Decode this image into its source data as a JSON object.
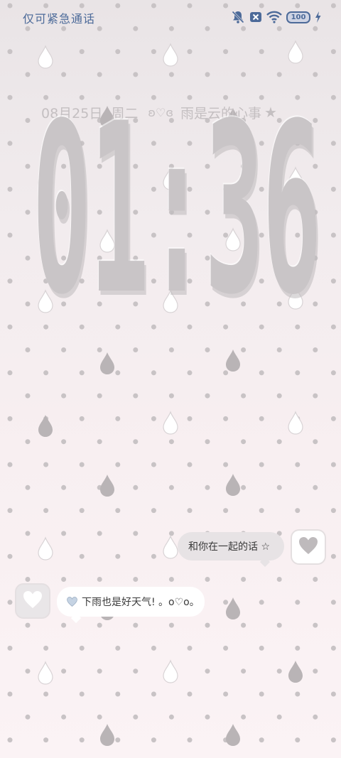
{
  "status_bar": {
    "emergency_text": "仅可紧急通话",
    "battery_level": "100",
    "icons": [
      "bell-muted-icon",
      "no-sim-icon",
      "wifi-icon",
      "battery-icon",
      "charging-icon"
    ]
  },
  "lockscreen": {
    "date": "08月25日",
    "weekday": "周二",
    "decoration": "ʚ♡ɞ",
    "motto": "雨是云的心事",
    "star": "★",
    "time": "01:36"
  },
  "chat": {
    "right_message": "和你在一起的话 ☆",
    "left_message": "下雨也是好天气! 。o♡o。",
    "left_icon": "blue-heart-icon",
    "avatar_icon": "heart-icon"
  },
  "colors": {
    "status_text": "#4c6a99",
    "clock": "#c9c5c7",
    "raindrop": "#b9b4b6",
    "dot": "#c8c3c5",
    "heart": "#bebabc"
  }
}
